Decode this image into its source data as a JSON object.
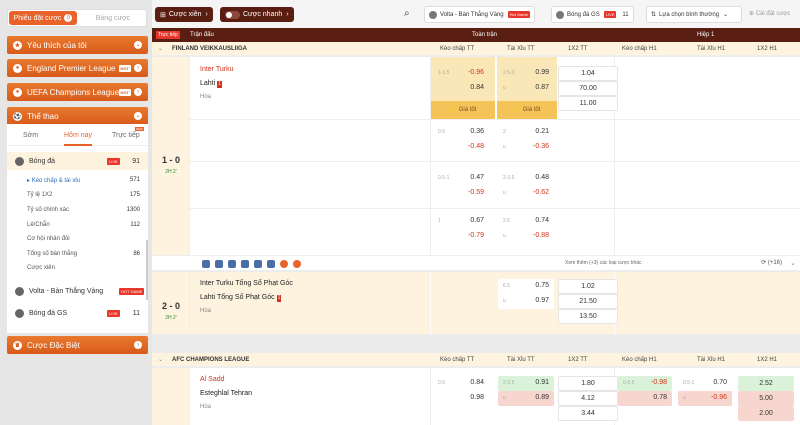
{
  "sidebar": {
    "slip_tab": "Phiếu đặt cược",
    "slip_count": "0",
    "board_tab": "Bảng cược",
    "favorites": "Yêu thích của tôi",
    "epl": "England Premier League",
    "ucl": "UEFA Champions League",
    "hot": "HOT",
    "sports": "Thể thao",
    "tabs": [
      "Sớm",
      "Hôm nay",
      "Trực tiếp"
    ],
    "new": "NEW",
    "football": {
      "label": "Bóng đá",
      "live": "LIVE",
      "count": "91"
    },
    "subs": [
      {
        "label": "Kèo chấp & tài xỉu",
        "count": "571"
      },
      {
        "label": "Tỷ lệ 1X2",
        "count": "175"
      },
      {
        "label": "Tỷ số chính xác",
        "count": "1300"
      },
      {
        "label": "Lẻ/Chẵn",
        "count": "112"
      },
      {
        "label": "Cơ hội nhân đôi",
        "count": ""
      },
      {
        "label": "Tổng số bàn thắng",
        "count": "86"
      },
      {
        "label": "Cược xiên",
        "count": ""
      }
    ],
    "volta": {
      "label": "Volta - Bàn Thắng Vàng",
      "tag": "HOT GAME"
    },
    "gs": {
      "label": "Bóng đá GS",
      "count": "11"
    },
    "special": "Cược Đặc Biệt"
  },
  "topbar": {
    "parlay": "Cược xiên",
    "quick": "Cược nhanh",
    "chip1": "Volta - Bàn Thắng Vàng",
    "chip1_tag": "Hot Game",
    "chip2": "Bóng đá GS",
    "chip2_tag": "LIVE",
    "chip2_count": "11",
    "sort": "Lựa chọn bình thường",
    "settings": "Cài đặt cược"
  },
  "header": {
    "live": "Trực tiếp",
    "match": "Trận đấu",
    "full": "Toàn trận",
    "half": "Hiệp 1"
  },
  "league1": {
    "name": "FINLAND VEIKKAUSLIIGA",
    "cols": [
      "Kèo chấp TT",
      "Tài Xỉu TT",
      "1X2 TT",
      "Kèo chấp H1",
      "Tài Xỉu H1",
      "1X2 H1"
    ]
  },
  "match1": {
    "home": "Inter Turku",
    "away": "Lahti",
    "red": "1",
    "draw": "Hòa",
    "score": "1 - 0",
    "period": "2H 2'",
    "lines": [
      {
        "hl": "1-1.5",
        "h1": "-0.96",
        "h2": "0.84",
        "ol": "2.5-3",
        "o1": "0.99",
        "u": "u",
        "o2": "0.87"
      },
      {
        "hl": "0.5",
        "h1": "0.36",
        "h2": "-0.48",
        "ol": "2",
        "o1": "0.21",
        "u": "u",
        "o2": "-0.36"
      },
      {
        "hl": "0.5-1",
        "h1": "0.47",
        "h2": "-0.59",
        "ol": "2-2.5",
        "o1": "0.48",
        "u": "u",
        "o2": "-0.62"
      },
      {
        "hl": "1",
        "h1": "0.67",
        "h2": "-0.79",
        "ol": "2.5",
        "o1": "0.74",
        "u": "u",
        "o2": "-0.88"
      }
    ],
    "x12": [
      "1.04",
      "70.00",
      "11.00"
    ],
    "best": "Giá tốt",
    "more": "Xem thêm (+3) các loại cược khác",
    "plus": "(+16)"
  },
  "match2": {
    "home": "Inter Turku Tổng Số Phạt Góc",
    "away": "Lahti Tổng Số Phạt Góc",
    "red": "1",
    "draw": "Hòa",
    "score": "2 - 0",
    "period": "2H 2'",
    "ol": "6.5",
    "o1": "0.75",
    "u": "u",
    "o2": "0.97",
    "x12": [
      "1.02",
      "21.50",
      "13.50"
    ]
  },
  "league2": {
    "name": "AFC CHAMPIONS LEAGUE",
    "cols": [
      "Kèo chấp TT",
      "Tài Xỉu TT",
      "1X2 TT",
      "Kèo chấp H1",
      "Tài Xỉu H1",
      "1X2 H1"
    ]
  },
  "match3": {
    "home": "Al Sadd",
    "away": "Esteghlal Tehran",
    "draw": "Hòa",
    "hl": "0.5",
    "h1": "0.84",
    "h2": "0.98",
    "ol": "2-2.5",
    "o1": "0.91",
    "u": "u",
    "o2": "0.89",
    "x12": [
      "1.80",
      "4.12",
      "3.44"
    ],
    "hh": "0-0.5",
    "hh1": "-0.98",
    "hh2": "0.78",
    "oh": "0.5-1",
    "oh1": "0.70",
    "uh": "u",
    "oh2": "-0.96",
    "x12h": [
      "2.52",
      "5.00",
      "2.00"
    ]
  }
}
